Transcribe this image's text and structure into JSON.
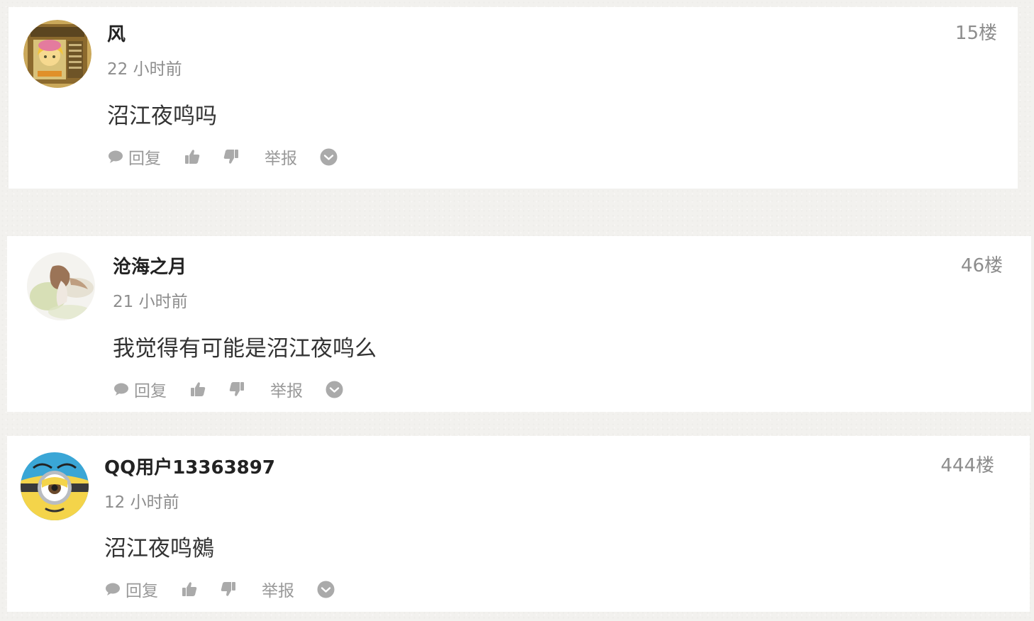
{
  "comments": [
    {
      "author": "风",
      "time": "22 小时前",
      "floor": "15楼",
      "content": "沼江夜鸣吗",
      "actions": {
        "reply": "回复",
        "report": "举报"
      }
    },
    {
      "author": "沧海之月",
      "time": "21 小时前",
      "floor": "46楼",
      "content": "我觉得有可能是沼江夜鸣么",
      "actions": {
        "reply": "回复",
        "report": "举报"
      }
    },
    {
      "author": "QQ用户13363897",
      "time": "12 小时前",
      "floor": "444楼",
      "content": "沼江夜鸣鵺",
      "actions": {
        "reply": "回复",
        "report": "举报"
      }
    }
  ],
  "icons": {
    "reply": "speech-bubble-icon",
    "like": "thumbs-up-icon",
    "dislike": "thumbs-down-icon",
    "more": "chevron-down-circle-icon"
  },
  "colors": {
    "page_background": "#f2f1ee",
    "card_background": "#ffffff",
    "author_text": "#222222",
    "meta_text": "#8d8d8d",
    "content_text": "#333333",
    "action_icon": "#aaaaaa"
  }
}
